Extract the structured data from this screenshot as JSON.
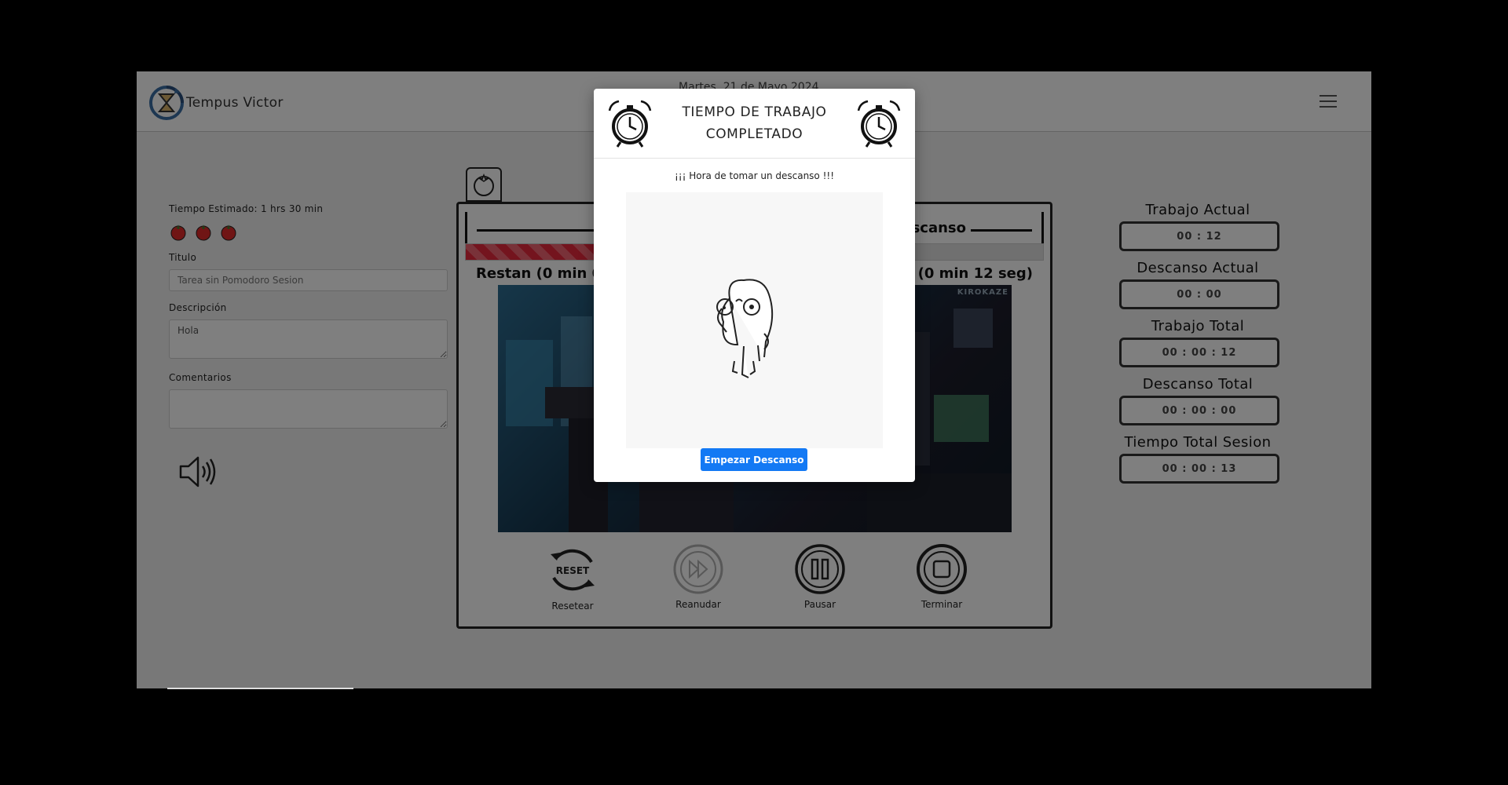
{
  "navbar": {
    "brand": "Tempus Victor",
    "date": "Martes, 21 de Mayo 2024",
    "menu_icon": "hamburger-menu-icon"
  },
  "form": {
    "estimated_time": "Tiempo Estimado: 1 hrs 30 min",
    "tomato_count": 3,
    "title_label": "Titulo",
    "title_placeholder": "Tarea sin Pomodoro Sesion",
    "description_label": "Descripción",
    "description_value": "Hola",
    "comments_label": "Comentarios",
    "comments_value": "",
    "sound_icon": "speaker-icon"
  },
  "timer": {
    "tab_icon": "tomato-icon",
    "mode_label": "Descanso",
    "progress_fraction": 0.28,
    "remaining_left": "Restan (0 min 0",
    "remaining_right": "n (0 min 12 seg)",
    "scene_watermark": "KIROKAZE",
    "controls": [
      {
        "label": "Resetear",
        "icon": "reset-icon"
      },
      {
        "label": "Reanudar",
        "icon": "fast-forward-icon"
      },
      {
        "label": "Pausar",
        "icon": "pause-icon"
      },
      {
        "label": "Terminar",
        "icon": "stop-icon"
      }
    ],
    "reset_icon_text": "RESET"
  },
  "stats": [
    {
      "title": "Trabajo Actual",
      "value": "00 : 12"
    },
    {
      "title": "Descanso Actual",
      "value": "00 : 00"
    },
    {
      "title": "Trabajo Total",
      "value": "00 : 00 : 12"
    },
    {
      "title": "Descanso Total",
      "value": "00 : 00 : 00"
    },
    {
      "title": "Tiempo Total Sesion",
      "value": "00 : 00 : 13"
    }
  ],
  "modal": {
    "title_line1": "TIEMPO DE TRABAJO",
    "title_line2": "COMPLETADO",
    "message": "¡¡¡ Hora de tomar un descanso !!!",
    "button": "Empezar Descanso",
    "alarm_icon": "alarm-clock-icon",
    "illustration": "thinking-character-illustration"
  },
  "colors": {
    "primary": "#1379f4",
    "progress": "#e8283c",
    "overlay": "rgba(0,0,0,0.5)"
  }
}
